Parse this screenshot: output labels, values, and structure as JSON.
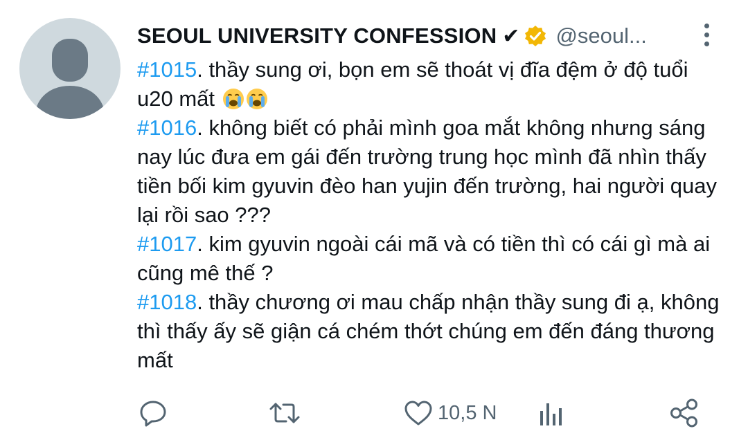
{
  "tweet": {
    "author_name": "SEOUL UNIVERSITY CONFESSION",
    "name_badge": "✔",
    "handle": "@seoul...",
    "entries": [
      {
        "tag": "#1015",
        "text": ". thầy sung ơi, bọn em sẽ thoát vị đĩa đệm ở độ tuổi u20 mất",
        "emojis": [
          "crying-face",
          "crying-face"
        ]
      },
      {
        "tag": "#1016",
        "text": ". không biết có phải mình goa mắt không nhưng sáng nay lúc đưa em gái đến trường trung học mình đã nhìn thấy tiền bối kim gyuvin đèo han yujin đến trường, hai người quay lại rồi sao ???"
      },
      {
        "tag": "#1017",
        "text": ". kim gyuvin ngoài cái mã và có tiền thì có cái gì mà ai cũng mê thế ?"
      },
      {
        "tag": "#1018",
        "text": ". thầy chương ơi mau chấp nhận thầy sung đi ạ, không thì thấy ấy sẽ giận cá chém thớt chúng em đến đáng thương mất"
      }
    ]
  },
  "actions": {
    "reply_icon": "reply-icon",
    "retweet_icon": "retweet-icon",
    "like_icon": "heart-icon",
    "like_count": "10,5 N",
    "views_icon": "analytics-icon",
    "share_icon": "share-icon"
  },
  "colors": {
    "link": "#1d9bf0",
    "secondary_text": "#536471",
    "verified_gold": "#f2b705",
    "avatar_bg": "#cfd9de",
    "avatar_fg": "#6b7a86"
  }
}
